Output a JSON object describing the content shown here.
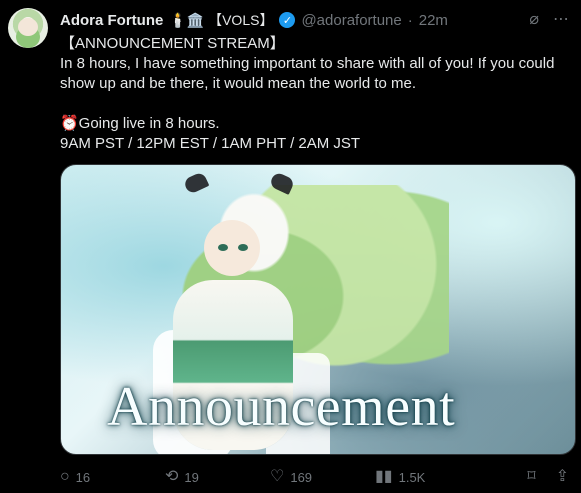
{
  "post": {
    "author_name": "Adora Fortune",
    "author_badges": "🕯️🏛️ 【VOLS】",
    "handle": "@adorafortune",
    "dot": "·",
    "time": "22m",
    "text_lines": [
      "【ANNOUNCEMENT STREAM】",
      "In 8 hours, I have something important to share with all of you! If you could show up and be there, it would mean the world to me.",
      "",
      "⏰Going live in 8 hours.",
      "9AM PST / 12PM EST / 1AM PHT / 2AM JST"
    ],
    "media_title": "Announcement"
  },
  "actions": {
    "replies": "16",
    "reposts": "19",
    "likes": "169",
    "views": "1.5K"
  },
  "icons": {
    "grok": "⌀",
    "more": "⋯",
    "reply": "○",
    "repost": "⟲",
    "like": "♡",
    "views": "▮▮",
    "bookmark": "⌑",
    "share": "⇪"
  },
  "colors": {
    "background": "#000000",
    "text": "#e7e9ea",
    "muted": "#71767b",
    "accent": "#1d9bf0"
  }
}
